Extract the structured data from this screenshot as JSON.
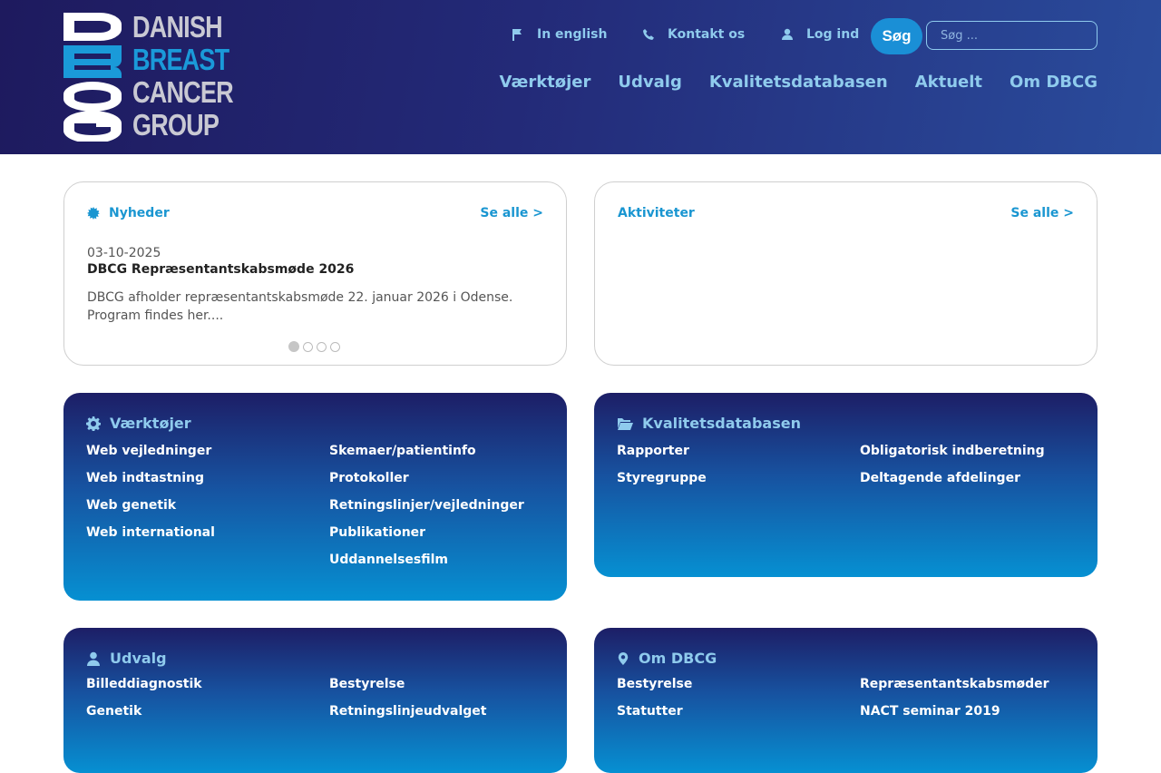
{
  "logo": {
    "words": [
      "DANISH",
      "BREAST",
      "CANCER",
      "GROUP"
    ],
    "colors": {
      "gray": "#c9c9d3",
      "blue": "#1a9ad9"
    }
  },
  "toplinks": {
    "english": {
      "label": "In english",
      "icon": "flag-icon"
    },
    "contact": {
      "label": "Kontakt os",
      "icon": "phone-icon"
    },
    "login": {
      "label": "Log ind",
      "icon": "user-icon"
    }
  },
  "search": {
    "button_label": "Søg",
    "placeholder": "Søg ..."
  },
  "nav": [
    "Værktøjer",
    "Udvalg",
    "Kvalitetsdatabasen",
    "Aktuelt",
    "Om DBCG"
  ],
  "news": {
    "title": "Nyheder",
    "see_all": "Se alle >",
    "date": "03-10-2025",
    "headline": "DBCG Repræsentantskabsmøde 2026",
    "text": "DBCG afholder repræsentantskabsmøde 22. januar 2026 i Odense. Program findes her....",
    "slide_count": 4,
    "active_slide": 1
  },
  "activities": {
    "title": "Aktiviteter",
    "see_all": "Se alle >"
  },
  "tools": {
    "title": "Værktøjer",
    "col1": [
      "Web vejledninger",
      "Web indtastning",
      "Web genetik",
      "Web international"
    ],
    "col2": [
      "Skemaer/patientinfo",
      "Protokoller",
      "Retningslinjer/vejledninger",
      "Publikationer",
      "Uddannelsesfilm"
    ]
  },
  "quality": {
    "title": "Kvalitetsdatabasen",
    "col1": [
      "Rapporter",
      "Styregruppe"
    ],
    "col2": [
      "Obligatorisk indberetning",
      "Deltagende afdelinger"
    ]
  },
  "committees": {
    "title": "Udvalg",
    "col1": [
      "Billeddiagnostik",
      "Genetik"
    ],
    "col2": [
      "Bestyrelse",
      "Retningslinjeudvalget"
    ]
  },
  "about": {
    "title": "Om DBCG",
    "col1": [
      "Bestyrelse",
      "Statutter"
    ],
    "col2": [
      "Repræsentantskabsmøder",
      "NACT seminar 2019"
    ]
  },
  "colors": {
    "accent": "#1a96d1",
    "header_dark": "#1e1a5e",
    "nav_text": "#8fcbed"
  }
}
